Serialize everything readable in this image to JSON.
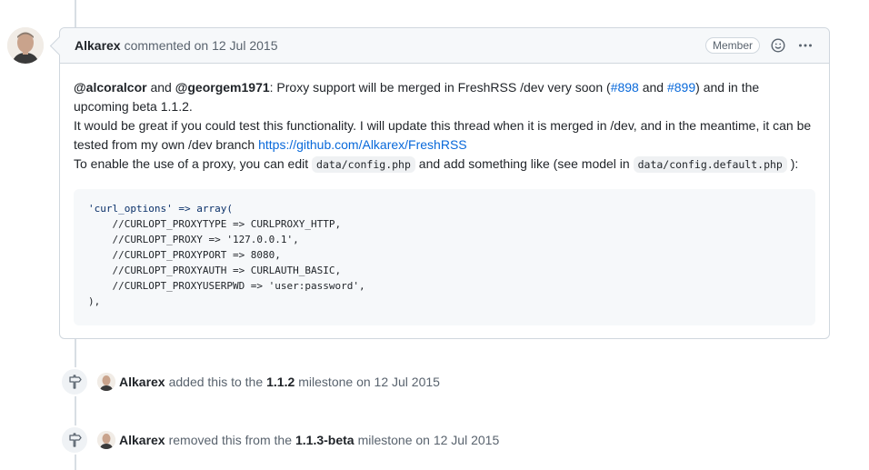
{
  "comment": {
    "author": "Alkarex",
    "action": "commented on 12 Jul 2015",
    "badge": "Member",
    "body": {
      "mention1": "@alcoralcor",
      "and1": "and",
      "mention2": "@georgem1971",
      "text1": ": Proxy support will be merged in FreshRSS /dev very soon (",
      "link1": "#898",
      "and2": "and",
      "link2": "#899",
      "text2": ") and in the upcoming beta 1.1.2.",
      "line2": "It would be great if you could test this functionality. I will update this thread when it is merged in /dev, and in the meantime, it can be tested from my own /dev branch",
      "branch_url": "https://github.com/Alkarex/FreshRSS",
      "line3a": "To enable the use of a proxy, you can edit",
      "code1": "data/config.php",
      "line3b": "and add something like (see model in",
      "code2": "data/config.default.php",
      "line3c": "):",
      "code_block": [
        "'curl_options' => array(",
        "    //CURLOPT_PROXYTYPE => CURLPROXY_HTTP,",
        "    //CURLOPT_PROXY => '127.0.0.1',",
        "    //CURLOPT_PROXYPORT => 8080,",
        "    //CURLOPT_PROXYAUTH => CURLAUTH_BASIC,",
        "    //CURLOPT_PROXYUSERPWD => 'user:password',",
        "),"
      ]
    }
  },
  "events": [
    {
      "author": "Alkarex",
      "pre": "added this to the",
      "milestone": "1.1.2",
      "post": "milestone on 12 Jul 2015"
    },
    {
      "author": "Alkarex",
      "pre": "removed this from the",
      "milestone": "1.1.3-beta",
      "post": "milestone on 12 Jul 2015"
    }
  ],
  "icons": {
    "smiley": "smiley-icon",
    "kebab": "kebab-horizontal-icon",
    "milestone": "milestone-icon"
  }
}
